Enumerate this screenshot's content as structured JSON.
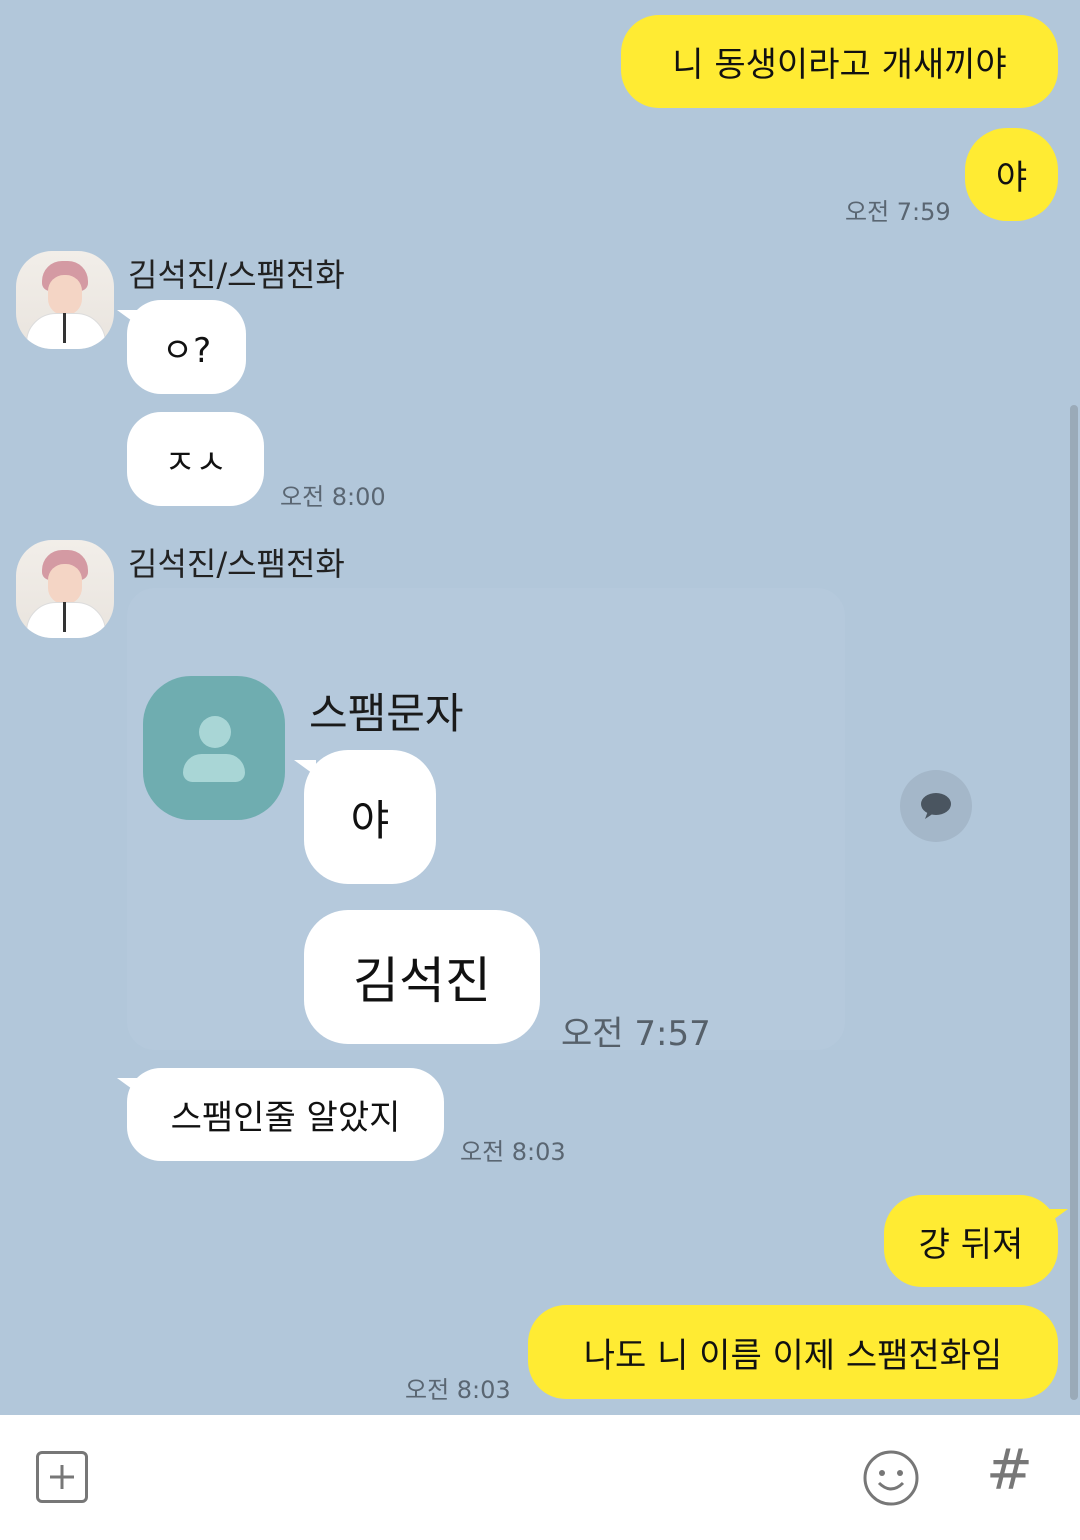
{
  "messages": {
    "m1": {
      "text": "니 동생이라고 개새끼야"
    },
    "m2": {
      "text": "야",
      "time": "오전 7:59"
    },
    "g1": {
      "sender": "김석진/스팸전화",
      "m3": "ㅇ?",
      "m4": "ㅈㅅ",
      "time": "오전 8:00"
    },
    "g2": {
      "sender": "김석진/스팸전화",
      "card": {
        "sender": "스팸문자",
        "m1": "야",
        "m2": "김석진",
        "time": "오전 7:57"
      },
      "m5": "스팸인줄 알았지",
      "time": "오전 8:03"
    },
    "m6": {
      "text": "걍 뒤져"
    },
    "m7": {
      "text": "나도 니 이름 이제 스팸전화임",
      "time": "오전 8:03"
    }
  },
  "colors": {
    "background": "#b2c7da",
    "my_bubble": "#ffeb33",
    "other_bubble": "#ffffff",
    "spam_avatar": "#6fadb0"
  },
  "icons": {
    "add": "plus-icon",
    "emoji": "emoji-icon",
    "tag": "hash-icon",
    "share": "speech-bubble-icon"
  }
}
